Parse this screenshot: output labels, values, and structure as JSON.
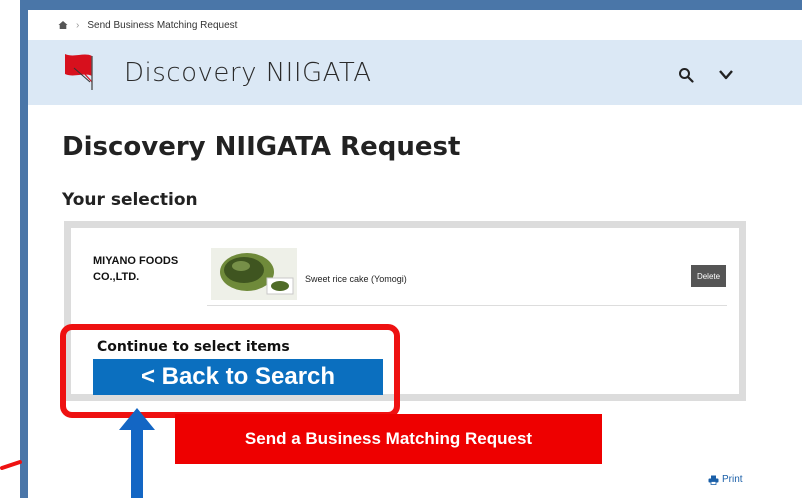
{
  "breadcrumb": {
    "current": "Send Business Matching Request"
  },
  "header": {
    "logo_text": "Discovery NIIGATA",
    "icons": [
      "search-icon",
      "chevron-down-icon"
    ]
  },
  "page": {
    "title": "Discovery NIIGATA Request",
    "section_title": "Your selection"
  },
  "selection": {
    "items": [
      {
        "company": "MIYANO FOODS CO.,LTD.",
        "product": "Sweet rice cake (Yomogi)",
        "delete_label": "Delete"
      }
    ],
    "continue_label": "Continue to select items",
    "back_label": "< Back to Search"
  },
  "actions": {
    "send_label": "Send a Business Matching Request",
    "print_label": "Print"
  },
  "colors": {
    "frame": "#4a76a8",
    "header_bg": "#dbe8f5",
    "back_button": "#0b6fbf",
    "send_button": "#ee0000",
    "highlight": "#ee1111",
    "logo_red": "#d7101d"
  }
}
